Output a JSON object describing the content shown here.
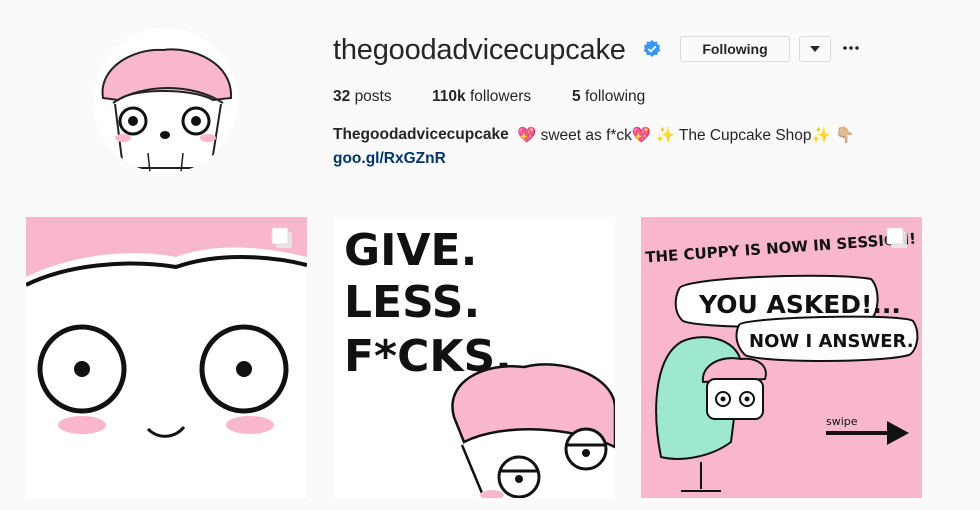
{
  "profile": {
    "username": "thegoodadvicecupcake",
    "follow_button": "Following",
    "stats": {
      "posts_count": "32",
      "posts_label": "posts",
      "followers_count": "110k",
      "followers_label": "followers",
      "following_count": "5",
      "following_label": "following"
    },
    "bio": {
      "name": "Thegoodadvicecupcake",
      "text": "💖 sweet as f*ck💖  ✨ The Cupcake Shop✨ 👇🏼",
      "link": "goo.gl/RxGZnR"
    }
  },
  "posts": [
    {
      "type": "illustration",
      "multi": true
    },
    {
      "type": "illustration",
      "text_lines": [
        "GIVE.",
        "LESS.",
        "F*CKS."
      ],
      "multi": false
    },
    {
      "type": "illustration",
      "text_lines": [
        "THE CUPPY IS NOW IN SESSION!",
        "YOU ASKED!...",
        "NOW I ANSWER.",
        "swipe"
      ],
      "multi": true
    }
  ],
  "colors": {
    "accent_pink": "#f8b7cd",
    "verified_blue": "#3897f0",
    "link_blue": "#003569",
    "chair_teal": "#9ee8d0"
  },
  "icons": [
    "verified-badge-icon",
    "chevron-down-icon",
    "more-options-icon",
    "multiple-posts-icon",
    "arrow-right-icon"
  ]
}
